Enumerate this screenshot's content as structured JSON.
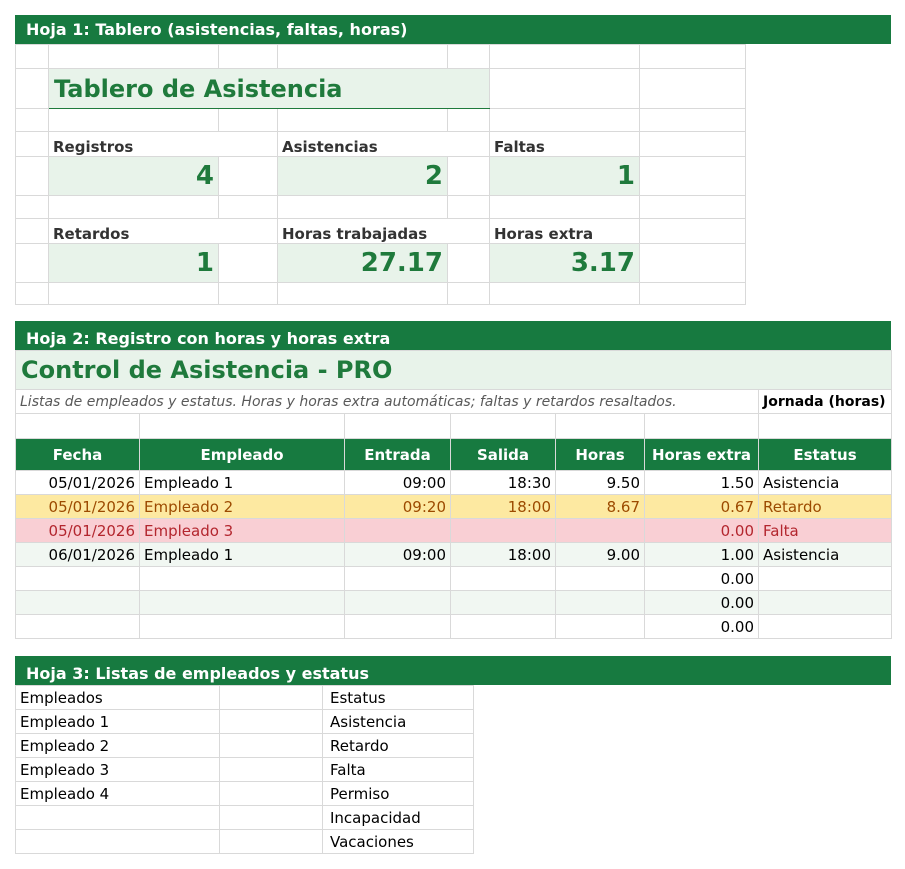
{
  "sheet1": {
    "header": "Hoja 1: Tablero (asistencias, faltas, horas)",
    "title": "Tablero de Asistencia",
    "kpis": [
      {
        "label": "Registros",
        "value": "4"
      },
      {
        "label": "Asistencias",
        "value": "2"
      },
      {
        "label": "Faltas",
        "value": "1"
      },
      {
        "label": "Retardos",
        "value": "1"
      },
      {
        "label": "Horas trabajadas",
        "value": "27.17"
      },
      {
        "label": "Horas extra",
        "value": "3.17"
      }
    ]
  },
  "sheet2": {
    "header": "Hoja 2: Registro con horas y horas extra",
    "title": "Control de Asistencia - PRO",
    "subtitle": "Listas de empleados y estatus. Horas y horas extra automáticas; faltas y retardos resaltados.",
    "jornada_label": "Jornada (horas)",
    "columns": [
      "Fecha",
      "Empleado",
      "Entrada",
      "Salida",
      "Horas",
      "Horas extra",
      "Estatus"
    ],
    "rows": [
      {
        "fecha": "05/01/2026",
        "empleado": "Empleado 1",
        "entrada": "09:00",
        "salida": "18:30",
        "horas": "9.50",
        "extra": "1.50",
        "estatus": "Asistencia"
      },
      {
        "fecha": "05/01/2026",
        "empleado": "Empleado 2",
        "entrada": "09:20",
        "salida": "18:00",
        "horas": "8.67",
        "extra": "0.67",
        "estatus": "Retardo"
      },
      {
        "fecha": "05/01/2026",
        "empleado": "Empleado 3",
        "entrada": "",
        "salida": "",
        "horas": "",
        "extra": "0.00",
        "estatus": "Falta"
      },
      {
        "fecha": "06/01/2026",
        "empleado": "Empleado 1",
        "entrada": "09:00",
        "salida": "18:00",
        "horas": "9.00",
        "extra": "1.00",
        "estatus": "Asistencia"
      },
      {
        "fecha": "",
        "empleado": "",
        "entrada": "",
        "salida": "",
        "horas": "",
        "extra": "0.00",
        "estatus": ""
      },
      {
        "fecha": "",
        "empleado": "",
        "entrada": "",
        "salida": "",
        "horas": "",
        "extra": "0.00",
        "estatus": ""
      },
      {
        "fecha": "",
        "empleado": "",
        "entrada": "",
        "salida": "",
        "horas": "",
        "extra": "0.00",
        "estatus": ""
      }
    ]
  },
  "sheet3": {
    "header": "Hoja 3: Listas de empleados y estatus",
    "empleados_header": "Empleados",
    "empleados": [
      "Empleado 1",
      "Empleado 2",
      "Empleado 3",
      "Empleado 4",
      "",
      ""
    ],
    "estatus_header": "Estatus",
    "estatus": [
      "Asistencia",
      "Retardo",
      "Falta",
      "Permiso",
      "Incapacidad",
      "Vacaciones"
    ]
  }
}
